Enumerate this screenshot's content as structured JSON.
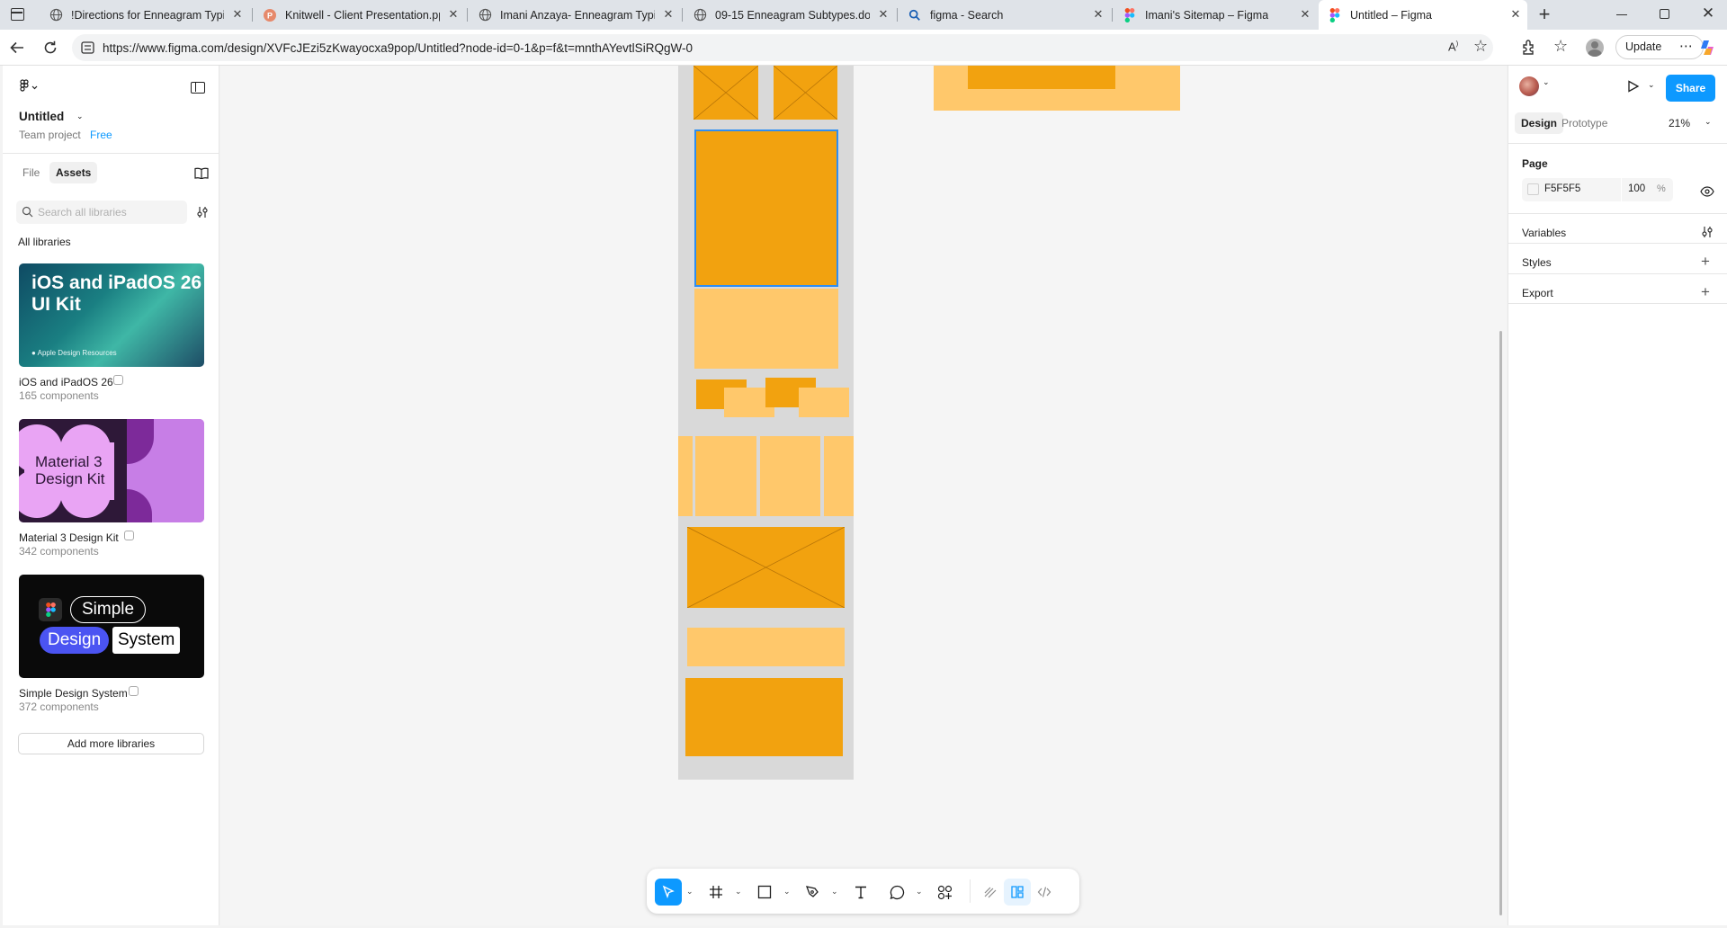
{
  "browser": {
    "tabs": [
      {
        "label": "!Directions for Enneagram Typing",
        "icon": "globe-icon"
      },
      {
        "label": "Knitwell - Client Presentation.pptx",
        "icon": "powerpoint-icon"
      },
      {
        "label": "Imani Anzaya- Enneagram Typing",
        "icon": "globe-icon"
      },
      {
        "label": "09-15 Enneagram Subtypes.docx",
        "icon": "globe-icon"
      },
      {
        "label": "figma - Search",
        "icon": "search-icon"
      },
      {
        "label": "Imani's Sitemap – Figma",
        "icon": "figma-icon"
      },
      {
        "label": "Untitled – Figma",
        "icon": "figma-icon"
      }
    ],
    "url": "https://www.figma.com/design/XVFcJEzi5zKwayocxa9pop/Untitled?node-id=0-1&p=f&t=mnthAYevtlSiRQgW-0",
    "update_label": "Update"
  },
  "left_panel": {
    "file_title": "Untitled",
    "team_label": "Team project",
    "plan_label": "Free",
    "tabs": [
      "File",
      "Assets"
    ],
    "search_placeholder": "Search all libraries",
    "all_libraries_label": "All libraries",
    "libraries": [
      {
        "name": "iOS and iPadOS 26",
        "count": "165 components",
        "thumb_title": "iOS and iPadOS 26 UI Kit",
        "thumb_caption": "Apple Design Resources"
      },
      {
        "name": "Material 3 Design Kit",
        "count": "342 components",
        "thumb_title": "Material 3 Design Kit"
      },
      {
        "name": "Simple Design System",
        "count": "372 components",
        "thumb_words": [
          "Simple",
          "Design",
          "System"
        ]
      }
    ],
    "add_button": "Add more libraries"
  },
  "right_panel": {
    "share_label": "Share",
    "tabs": [
      "Design",
      "Prototype"
    ],
    "zoom": "21%",
    "page_section": "Page",
    "page_color": "F5F5F5",
    "page_opacity": "100",
    "opacity_unit": "%",
    "sections": [
      "Variables",
      "Styles",
      "Export"
    ]
  },
  "help_label": "?",
  "colors": {
    "accent": "#0d99ff",
    "block_dark": "#f2a20f",
    "block_light": "#ffc86b",
    "frame_gray": "#d9d9d9"
  }
}
